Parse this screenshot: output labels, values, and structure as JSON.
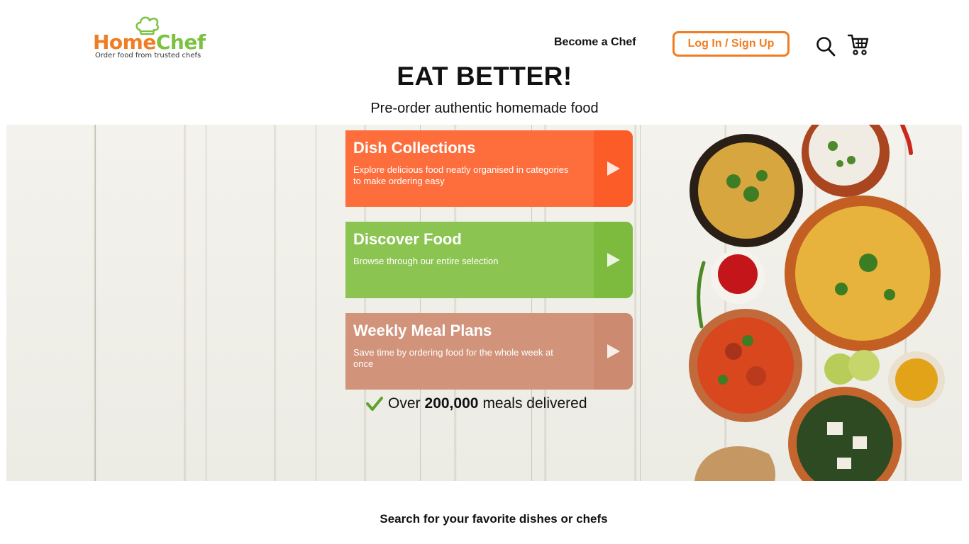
{
  "header": {
    "logo": {
      "word_home": "Home",
      "word_chef": "Chef",
      "tagline": "Order food from trusted chefs"
    },
    "nav": {
      "become_chef": "Become a Chef",
      "login": "Log In / Sign Up",
      "search_icon": "search-icon",
      "cart_icon": "cart-icon"
    }
  },
  "hero": {
    "headline": "EAT BETTER!",
    "subheadline": "Pre-order authentic homemade food",
    "cards": [
      {
        "title": "Dish Collections",
        "description": "Explore delicious food neatly organised in categories to make ordering easy",
        "color": "#fe6e3d"
      },
      {
        "title": "Discover Food",
        "description": "Browse through our entire selection",
        "color": "#8cc451"
      },
      {
        "title": "Weekly Meal Plans",
        "description": "Save time by ordering food for the whole week at once",
        "color": "#d1937a"
      }
    ],
    "stats": {
      "prefix": "Over",
      "count": "200,000",
      "suffix": "meals delivered"
    }
  },
  "search": {
    "prompt": "Search for your favorite dishes or chefs"
  },
  "colors": {
    "brand_orange": "#f07d22",
    "brand_green": "#7cc242"
  }
}
